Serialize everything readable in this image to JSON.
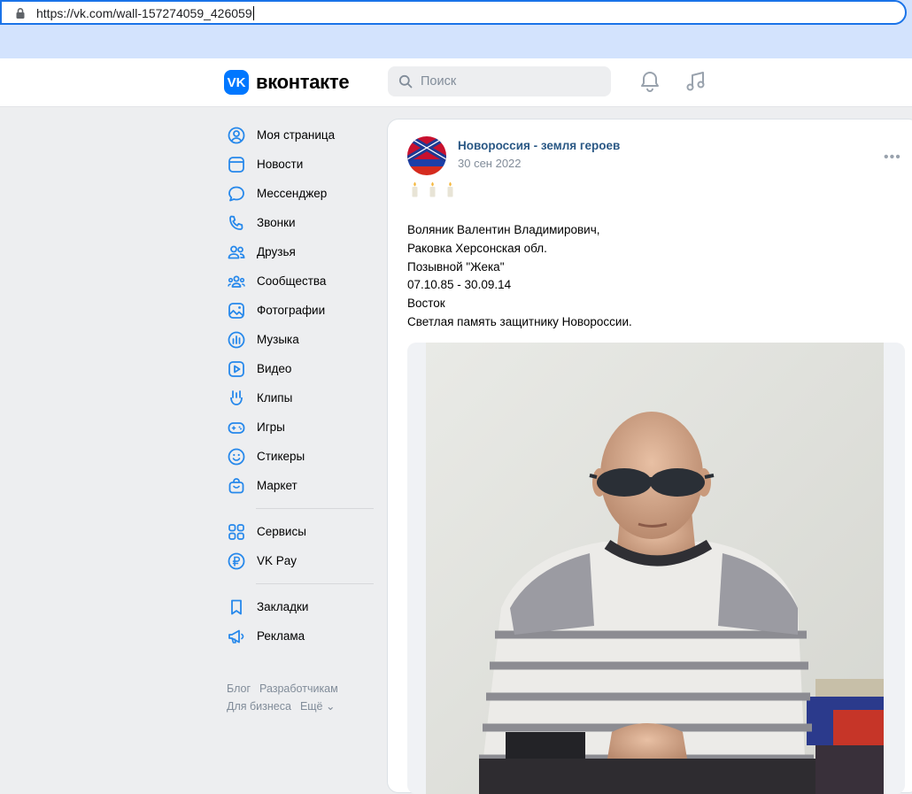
{
  "browser": {
    "url": "https://vk.com/wall-157274059_426059"
  },
  "header": {
    "logo_mark": "VK",
    "logo_text": "вконтакте",
    "search_placeholder": "Поиск",
    "icons": [
      "bell-icon",
      "music-note-icon"
    ]
  },
  "sidebar": {
    "items": [
      {
        "label": "Моя страница",
        "icon": "user-circle-icon"
      },
      {
        "label": "Новости",
        "icon": "newsfeed-icon"
      },
      {
        "label": "Мессенджер",
        "icon": "message-bubble-icon"
      },
      {
        "label": "Звонки",
        "icon": "phone-icon"
      },
      {
        "label": "Друзья",
        "icon": "friends-icon"
      },
      {
        "label": "Сообщества",
        "icon": "communities-icon"
      },
      {
        "label": "Фотографии",
        "icon": "photo-icon"
      },
      {
        "label": "Музыка",
        "icon": "music-icon"
      },
      {
        "label": "Видео",
        "icon": "video-icon"
      },
      {
        "label": "Клипы",
        "icon": "clips-icon"
      },
      {
        "label": "Игры",
        "icon": "gamepad-icon"
      },
      {
        "label": "Стикеры",
        "icon": "smile-icon"
      },
      {
        "label": "Маркет",
        "icon": "market-bag-icon"
      }
    ],
    "items2": [
      {
        "label": "Сервисы",
        "icon": "services-grid-icon"
      },
      {
        "label": "VK Pay",
        "icon": "ruble-icon"
      }
    ],
    "items3": [
      {
        "label": "Закладки",
        "icon": "bookmark-icon"
      },
      {
        "label": "Реклама",
        "icon": "megaphone-icon"
      }
    ],
    "footer": {
      "blog": "Блог",
      "developers": "Разработчикам",
      "business": "Для бизнеса",
      "more": "Ещё ⌄"
    }
  },
  "post": {
    "author": "Новороссия - земля героев",
    "date": "30 сен 2022",
    "more": "•••",
    "emoji": "🕯🕯🕯",
    "lines": [
      "Воляник Валентин Владимирович,",
      "Раковка Херсонская обл.",
      "Позывной \"Жека\"",
      "07.10.85 - 30.09.14",
      "Восток",
      "Светлая память защитнику Новороссии."
    ]
  },
  "colors": {
    "accent": "#0077ff",
    "link": "#2a5885",
    "muted": "#818c99",
    "icon": "#2688eb"
  }
}
